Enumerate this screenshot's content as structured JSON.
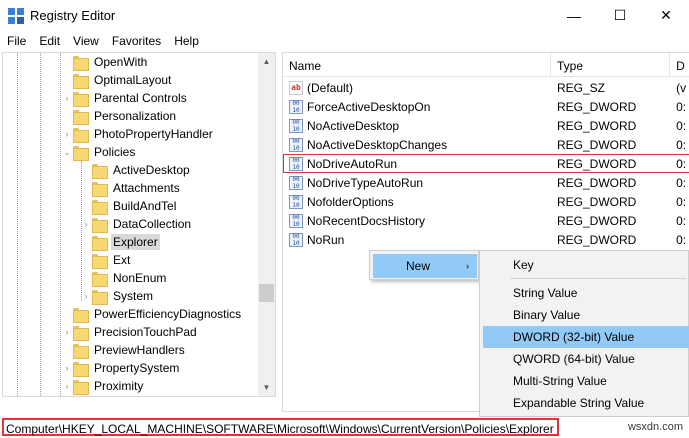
{
  "window": {
    "title": "Registry Editor"
  },
  "window_controls": {
    "minimize": "—",
    "maximize": "☐",
    "close": "✕"
  },
  "menu": [
    "File",
    "Edit",
    "View",
    "Favorites",
    "Help"
  ],
  "tree": [
    {
      "label": "OpenWith",
      "expand": ""
    },
    {
      "label": "OptimalLayout",
      "expand": ""
    },
    {
      "label": "Parental Controls",
      "expand": "›"
    },
    {
      "label": "Personalization",
      "expand": ""
    },
    {
      "label": "PhotoPropertyHandler",
      "expand": "›"
    },
    {
      "label": "Policies",
      "expand": "⌄"
    },
    {
      "label": "ActiveDesktop",
      "expand": ""
    },
    {
      "label": "Attachments",
      "expand": ""
    },
    {
      "label": "BuildAndTel",
      "expand": ""
    },
    {
      "label": "DataCollection",
      "expand": "›"
    },
    {
      "label": "Explorer",
      "expand": "",
      "selected": true
    },
    {
      "label": "Ext",
      "expand": ""
    },
    {
      "label": "NonEnum",
      "expand": ""
    },
    {
      "label": "System",
      "expand": "›"
    },
    {
      "label": "PowerEfficiencyDiagnostics",
      "expand": ""
    },
    {
      "label": "PrecisionTouchPad",
      "expand": "›"
    },
    {
      "label": "PreviewHandlers",
      "expand": ""
    },
    {
      "label": "PropertySystem",
      "expand": "›"
    },
    {
      "label": "Proximity",
      "expand": "›"
    }
  ],
  "list": {
    "headers": {
      "name": "Name",
      "type": "Type",
      "data": "D"
    },
    "rows": [
      {
        "name": "(Default)",
        "type": "REG_SZ",
        "data": "(v",
        "icon": "string-value-icon"
      },
      {
        "name": "ForceActiveDesktopOn",
        "type": "REG_DWORD",
        "data": "0:",
        "icon": "dword-value-icon"
      },
      {
        "name": "NoActiveDesktop",
        "type": "REG_DWORD",
        "data": "0:",
        "icon": "dword-value-icon"
      },
      {
        "name": "NoActiveDesktopChanges",
        "type": "REG_DWORD",
        "data": "0:",
        "icon": "dword-value-icon"
      },
      {
        "name": "NoDriveAutoRun",
        "type": "REG_DWORD",
        "data": "0:",
        "icon": "dword-value-icon",
        "highlighted": true
      },
      {
        "name": "NoDriveTypeAutoRun",
        "type": "REG_DWORD",
        "data": "0:",
        "icon": "dword-value-icon"
      },
      {
        "name": "NofolderOptions",
        "type": "REG_DWORD",
        "data": "0:",
        "icon": "dword-value-icon"
      },
      {
        "name": "NoRecentDocsHistory",
        "type": "REG_DWORD",
        "data": "0:",
        "icon": "dword-value-icon"
      },
      {
        "name": "NoRun",
        "type": "REG_DWORD",
        "data": "0:",
        "icon": "dword-value-icon"
      }
    ]
  },
  "context_menu": {
    "new_label": "New",
    "arrow": "›"
  },
  "submenu": [
    {
      "label": "Key"
    },
    {
      "label": "String Value"
    },
    {
      "label": "Binary Value"
    },
    {
      "label": "DWORD (32-bit) Value",
      "highlighted": true
    },
    {
      "label": "QWORD (64-bit) Value"
    },
    {
      "label": "Multi-String Value"
    },
    {
      "label": "Expandable String Value"
    }
  ],
  "status": {
    "path": "Computer\\HKEY_LOCAL_MACHINE\\SOFTWARE\\Microsoft\\Windows\\CurrentVersion\\Policies\\Explorer",
    "watermark": "wsxdn.com"
  },
  "colors": {
    "selection": "#91c9f7",
    "outline": "#e0343a",
    "folder": "#f8d775"
  }
}
